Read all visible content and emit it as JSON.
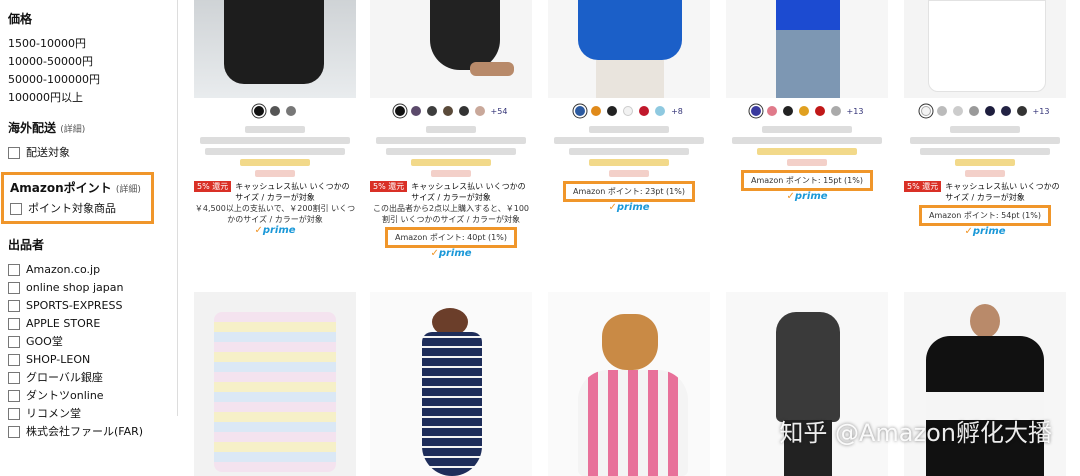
{
  "sidebar": {
    "price_heading": "価格",
    "price_ranges": [
      "1500-10000円",
      "10000-50000円",
      "50000-100000円",
      "100000円以上"
    ],
    "overseas_heading": "海外配送",
    "overseas_detail": "(詳細)",
    "overseas_option": "配送対象",
    "points_heading": "Amazonポイント",
    "points_detail": "(詳細)",
    "points_option": "ポイント対象商品",
    "seller_heading": "出品者",
    "sellers": [
      "Amazon.co.jp",
      "online shop japan",
      "SPORTS-EXPRESS",
      "APPLE STORE",
      "GOO堂",
      "SHOP-LEON",
      "グローバル銀座",
      "ダントツonline",
      "リコメン堂",
      "株式会社ファール(FAR)"
    ]
  },
  "products": [
    {
      "swatches": [
        "#111111",
        "#555555",
        "#777777"
      ],
      "more": "",
      "badge": "5% 還元",
      "promo": "キャッシュレス払い いくつかのサイズ / カラーが対象",
      "note": "￥4,500以上の支払いで、￥200割引 いくつかのサイズ / カラーが対象",
      "points": "",
      "prime": "prime"
    },
    {
      "swatches": [
        "#111111",
        "#5b4a6b",
        "#3d3d3d",
        "#5a4a3a",
        "#333333",
        "#c9a89a"
      ],
      "more": "+54",
      "badge": "5% 還元",
      "promo": "キャッシュレス払い いくつかのサイズ / カラーが対象",
      "note": "この出品者から2点以上購入すると、￥100割引 いくつかのサイズ / カラーが対象",
      "points": "Amazon ポイント: 40pt (1%)",
      "prime": "prime"
    },
    {
      "swatches": [
        "#2c5aa0",
        "#e08a1a",
        "#222222",
        "#f2f2f2",
        "#c0182c",
        "#8fc9e0"
      ],
      "more": "+8",
      "badge": "",
      "promo": "",
      "note": "",
      "points": "Amazon ポイント: 23pt (1%)",
      "prime": "prime"
    },
    {
      "swatches": [
        "#3a3a9e",
        "#e07a8a",
        "#222222",
        "#e0a020",
        "#c01818",
        "#aaaaaa"
      ],
      "more": "+13",
      "badge": "",
      "promo": "",
      "note": "",
      "points": "Amazon ポイント: 15pt (1%)",
      "prime": "prime"
    },
    {
      "swatches": [
        "#f4f4f4",
        "#bbbbbb",
        "#cccccc",
        "#999999",
        "#1d1d3d",
        "#222244",
        "#333333"
      ],
      "more": "+13",
      "badge": "5% 還元",
      "promo": "キャッシュレス払い いくつかのサイズ / カラーが対象",
      "note": "",
      "points": "Amazon ポイント: 54pt (1%)",
      "prime": "prime"
    }
  ],
  "watermark": "知乎 @Amazon孵化大播"
}
